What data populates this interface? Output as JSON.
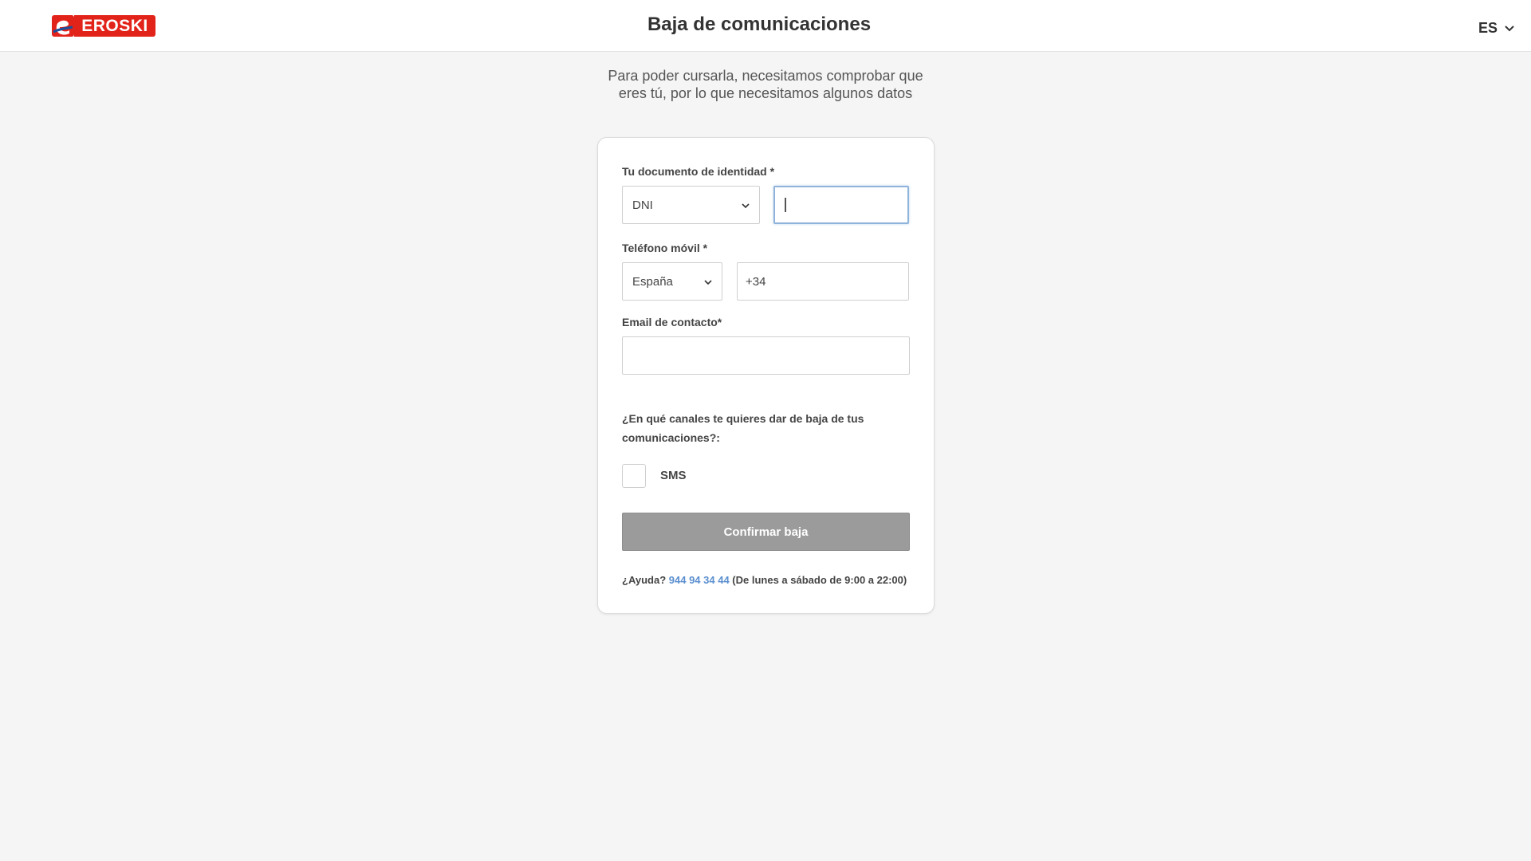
{
  "header": {
    "logo_text": "EROSKI",
    "title": "Baja de comunicaciones",
    "language": "ES"
  },
  "intro": {
    "text": "Para poder cursarla, necesitamos comprobar que eres tú, por lo que necesitamos algunos datos"
  },
  "form": {
    "document": {
      "label": "Tu documento de identidad *",
      "type_selected": "DNI",
      "number_value": ""
    },
    "phone": {
      "label": "Teléfono móvil *",
      "country_selected": "España",
      "prefix_value": "+34"
    },
    "email": {
      "label": "Email de contacto*",
      "value": ""
    },
    "channels": {
      "question": "¿En qué canales te quieres dar de baja de tus comunicaciones?:",
      "options": [
        {
          "label": "SMS",
          "checked": false
        }
      ]
    },
    "submit_label": "Confirmar baja"
  },
  "help": {
    "prefix": "¿Ayuda?",
    "phone": "944 94 34 44",
    "hours": "(De lunes a sábado de 9:00 a 22:00)"
  },
  "colors": {
    "brand_red": "#e2231a",
    "link_blue": "#5b8fd0",
    "button_disabled": "#9b9b9b"
  }
}
